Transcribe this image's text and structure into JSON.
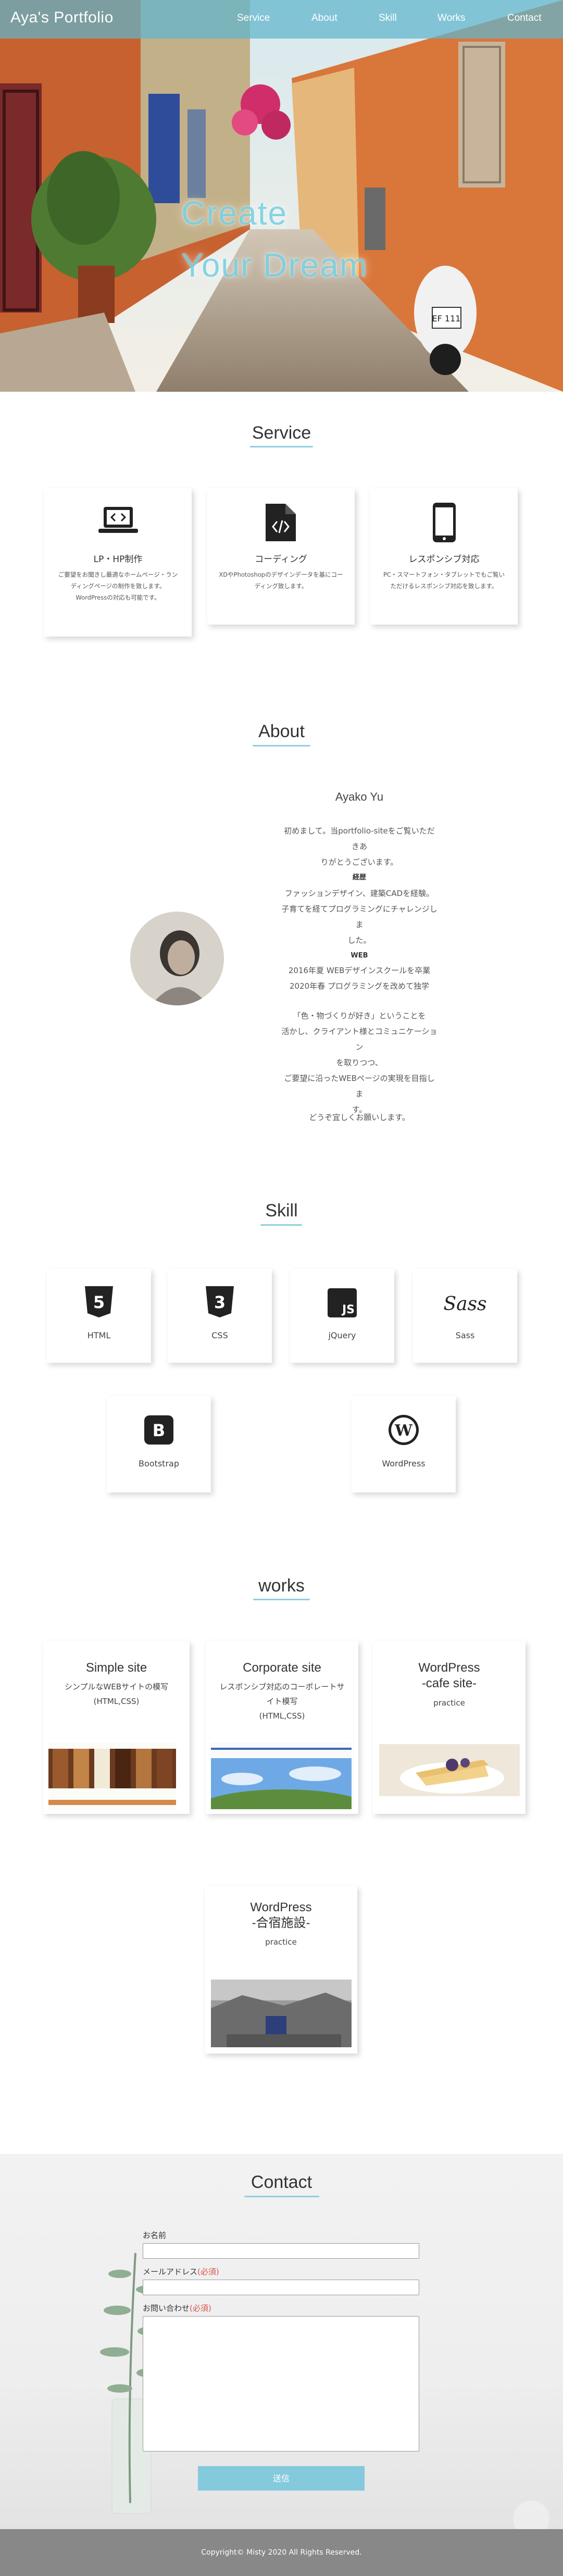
{
  "header": {
    "logo": "Aya's Portfolio",
    "nav": [
      "Service",
      "About",
      "Skill",
      "Works",
      "Contact"
    ]
  },
  "hero": {
    "line1": "Create",
    "line2": "Your Dream",
    "license_plate": "EF 111"
  },
  "service": {
    "title": "Service",
    "items": [
      {
        "icon": "laptop-code-icon",
        "title": "LP・HP制作",
        "text": [
          "ご要望をお聞きし最適なホームページ・ラン",
          "ディングページの制作を致します。",
          "WordPressの対応も可能です。"
        ]
      },
      {
        "icon": "code-file-icon",
        "title": "コーディング",
        "text": [
          "XDやPhotoshopのデザインデータを基にコー",
          "ディング致します。"
        ]
      },
      {
        "icon": "mobile-phone-icon",
        "title": "レスポンシブ対応",
        "text": [
          "PC・スマートフォン・タブレットでもご覧い",
          "ただけるレスポンシブ対応を致します。"
        ]
      }
    ]
  },
  "about": {
    "title": "About",
    "name": "Ayako Yu",
    "greeting": [
      "初めまして。当portfolio-siteをご覧いただきあ",
      "りがとうございます。"
    ],
    "career_heading": "経歴",
    "career": [
      "ファッションデザイン、建築CADを経験。",
      "子育てを経てプログラミングにチャレンジしま",
      "した。"
    ],
    "web_heading": "WEB",
    "web": [
      "2016年夏 WEBデザインスクールを卒業",
      "2020年春 プログラミングを改めて独学"
    ],
    "message": [
      "「色・物づくりが好き」ということを",
      "活かし、クライアント様とコミュニケーション",
      "を取りつつ、",
      "ご要望に沿ったWEBページの実現を目指しま",
      "す。"
    ],
    "closing": "どうぞ宜しくお願いします。"
  },
  "skill": {
    "title": "Skill",
    "items": [
      {
        "label": "HTML",
        "glyph": "5",
        "icon": "html5-icon"
      },
      {
        "label": "CSS",
        "glyph": "3",
        "icon": "css3-icon"
      },
      {
        "label": "jQuery",
        "glyph": "JS",
        "icon": "js-icon"
      },
      {
        "label": "Sass",
        "glyph": "Sass",
        "icon": "sass-icon"
      },
      {
        "label": "Bootstrap",
        "glyph": "B",
        "icon": "bootstrap-icon"
      },
      {
        "label": "WordPress",
        "glyph": "W",
        "icon": "wordpress-icon"
      }
    ]
  },
  "works": {
    "title": "works",
    "items": [
      {
        "title": [
          "Simple site"
        ],
        "desc": [
          "シンプルなWEBサイトの模写",
          "(HTML,CSS)"
        ]
      },
      {
        "title": [
          "Corporate site"
        ],
        "desc": [
          "レスポンシブ対応のコーポレートサ",
          "イト模写",
          "(HTML,CSS)"
        ]
      },
      {
        "title": [
          "WordPress",
          "-cafe site-"
        ],
        "desc": [
          "practice"
        ]
      },
      {
        "title": [
          "WordPress",
          "-合宿施設-"
        ],
        "desc": [
          "practice"
        ]
      }
    ]
  },
  "contact": {
    "title": "Contact",
    "name_label": "お名前",
    "email_label": "メールアドレス",
    "required": "(必須)",
    "message_label": "お問い合わせ",
    "submit": "送信"
  },
  "footer": {
    "copyright": "Copyright© Misty 2020 All Rights Reserved."
  },
  "colors": {
    "accent": "#84c9dc",
    "header": "#60b5cd",
    "footer": "#888888",
    "required": "#d9534f"
  }
}
